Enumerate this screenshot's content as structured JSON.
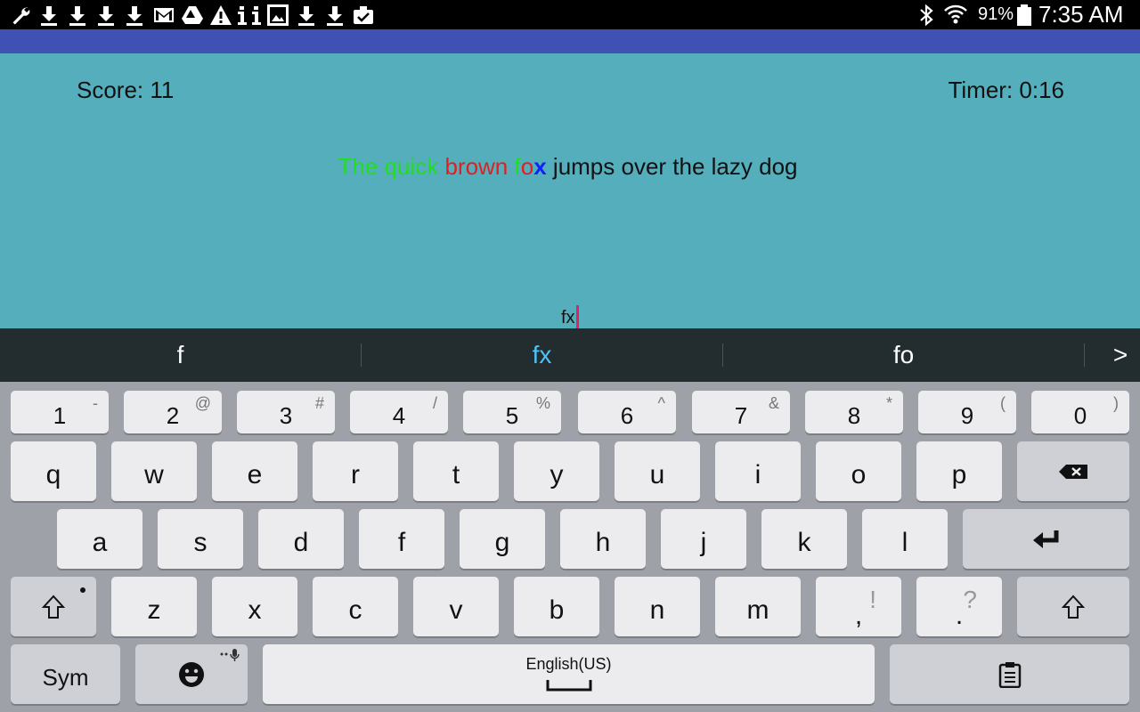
{
  "status_bar": {
    "left_icons": [
      "wrench-icon",
      "download-icon",
      "download-icon",
      "download-icon",
      "download-icon",
      "gmail-icon",
      "drive-icon",
      "warning-icon",
      "info-icon",
      "info-icon",
      "image-icon",
      "download-icon",
      "download-icon",
      "clipboard-check-icon"
    ],
    "battery": "91%",
    "time": "7:35 AM"
  },
  "game": {
    "score": "Score: 11",
    "timer": "Timer: 0:16",
    "sentence": {
      "typed": "The quick ",
      "wrong": "brown",
      "space": " ",
      "current_ok": "f",
      "current_bad": "o",
      "current_focus": "x",
      "remaining": " jumps over the lazy dog"
    },
    "input_value": "fx"
  },
  "suggestions": [
    "f",
    "fx",
    "fo"
  ],
  "suggestions_more": ">",
  "keyboard": {
    "number_row": [
      {
        "key": "1",
        "hint": "-"
      },
      {
        "key": "2",
        "hint": "@"
      },
      {
        "key": "3",
        "hint": "#"
      },
      {
        "key": "4",
        "hint": "/"
      },
      {
        "key": "5",
        "hint": "%"
      },
      {
        "key": "6",
        "hint": "^"
      },
      {
        "key": "7",
        "hint": "&"
      },
      {
        "key": "8",
        "hint": "*"
      },
      {
        "key": "9",
        "hint": "("
      },
      {
        "key": "0",
        "hint": ")"
      }
    ],
    "row1": [
      "q",
      "w",
      "e",
      "r",
      "t",
      "y",
      "u",
      "i",
      "o",
      "p"
    ],
    "row2": [
      "a",
      "s",
      "d",
      "f",
      "g",
      "h",
      "j",
      "k",
      "l"
    ],
    "row3": [
      "z",
      "x",
      "c",
      "v",
      "b",
      "n",
      "m"
    ],
    "comma": {
      "key": ",",
      "hint": "!"
    },
    "period": {
      "key": ".",
      "hint": "?"
    },
    "sym": "Sym",
    "space_label": "English(US)",
    "colors": {
      "accent_suggestion": "#4fc3f7",
      "cursor": "#e91e63",
      "correct": "#22dd22",
      "wrong": "#e02020",
      "focus": "#1020ff"
    }
  }
}
